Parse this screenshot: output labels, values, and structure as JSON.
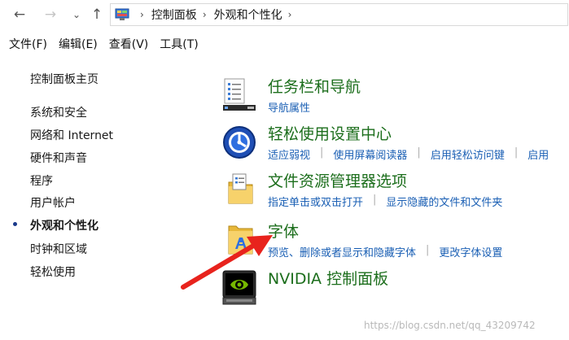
{
  "address_bar": {
    "breadcrumbs": [
      "控制面板",
      "外观和个性化"
    ]
  },
  "menu": [
    "文件(F)",
    "编辑(E)",
    "查看(V)",
    "工具(T)"
  ],
  "left_nav": {
    "home": "控制面板主页",
    "items": [
      "系统和安全",
      "网络和 Internet",
      "硬件和声音",
      "程序",
      "用户帐户",
      "外观和个性化",
      "时钟和区域",
      "轻松使用"
    ],
    "current_index": 5
  },
  "categories": [
    {
      "title": "任务栏和导航",
      "icon": "taskbar-icon",
      "links": [
        "导航属性"
      ]
    },
    {
      "title": "轻松使用设置中心",
      "icon": "ease-of-access-icon",
      "links": [
        "适应弱视",
        "使用屏幕阅读器",
        "启用轻松访问键",
        "启用"
      ]
    },
    {
      "title": "文件资源管理器选项",
      "icon": "folder-options-icon",
      "links": [
        "指定单击或双击打开",
        "显示隐藏的文件和文件夹"
      ]
    },
    {
      "title": "字体",
      "icon": "fonts-folder-icon",
      "links": [
        "预览、删除或者显示和隐藏字体",
        "更改字体设置"
      ]
    },
    {
      "title": "NVIDIA 控制面板",
      "icon": "nvidia-icon",
      "links": []
    }
  ],
  "watermark": "https://blog.csdn.net/qq_43209742",
  "colors": {
    "title_green": "#1c6e1c",
    "link_blue": "#1a5fb4",
    "arrow_red": "#e8231d"
  }
}
